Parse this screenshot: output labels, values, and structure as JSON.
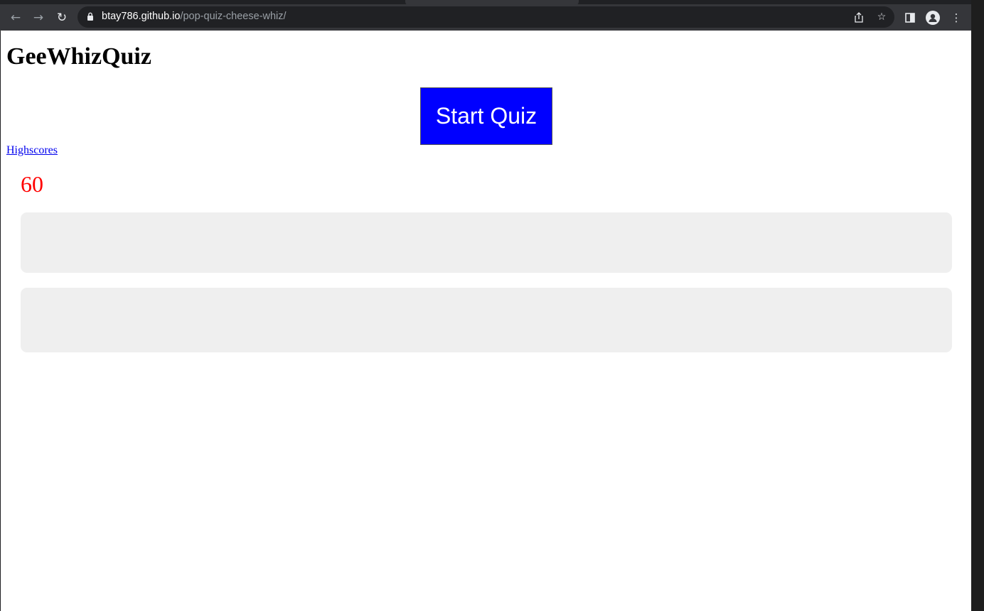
{
  "browser": {
    "url_host": "btay786.github.io",
    "url_path": "/pop-quiz-cheese-whiz/",
    "icons": [
      "back-icon",
      "forward-icon",
      "reload-icon",
      "lock-icon",
      "share-icon",
      "bookmark-star-icon",
      "side-panel-icon",
      "profile-icon",
      "menu-icon"
    ]
  },
  "page": {
    "title": "GeeWhizQuiz",
    "start_button": "Start Quiz",
    "highscores_link": "Highscores",
    "timer": "60"
  },
  "colors": {
    "start_button_bg": "#0000ff",
    "timer": "#ff0000",
    "card_bg": "#efefef"
  }
}
